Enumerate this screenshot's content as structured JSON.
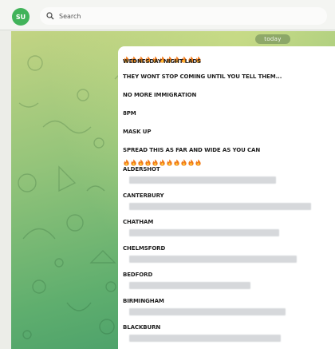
{
  "profile": {
    "initials": "SU"
  },
  "search": {
    "placeholder": "Search"
  },
  "chat": {
    "date_chip": "today"
  },
  "message": {
    "intro": [
      "WEDNESDAY NIGHT LADS",
      "THEY WONT STOP COMING UNTIL YOU TELL THEM...",
      "NO MORE IMMIGRATION",
      "8PM",
      "MASK UP",
      "SPREAD THIS AS FAR AND WIDE AS YOU CAN"
    ],
    "towns": [
      "ALDERSHOT",
      "CANTERBURY",
      "CHATHAM",
      "CHELMSFORD",
      "BEDFORD",
      "BIRMINGHAM",
      "BLACKBURN"
    ],
    "fire_emoji_count": 11
  },
  "colors": {
    "accent": "#41b35a",
    "fire": "#f07a1a"
  },
  "icons": [
    "search-icon",
    "fire-icon"
  ]
}
